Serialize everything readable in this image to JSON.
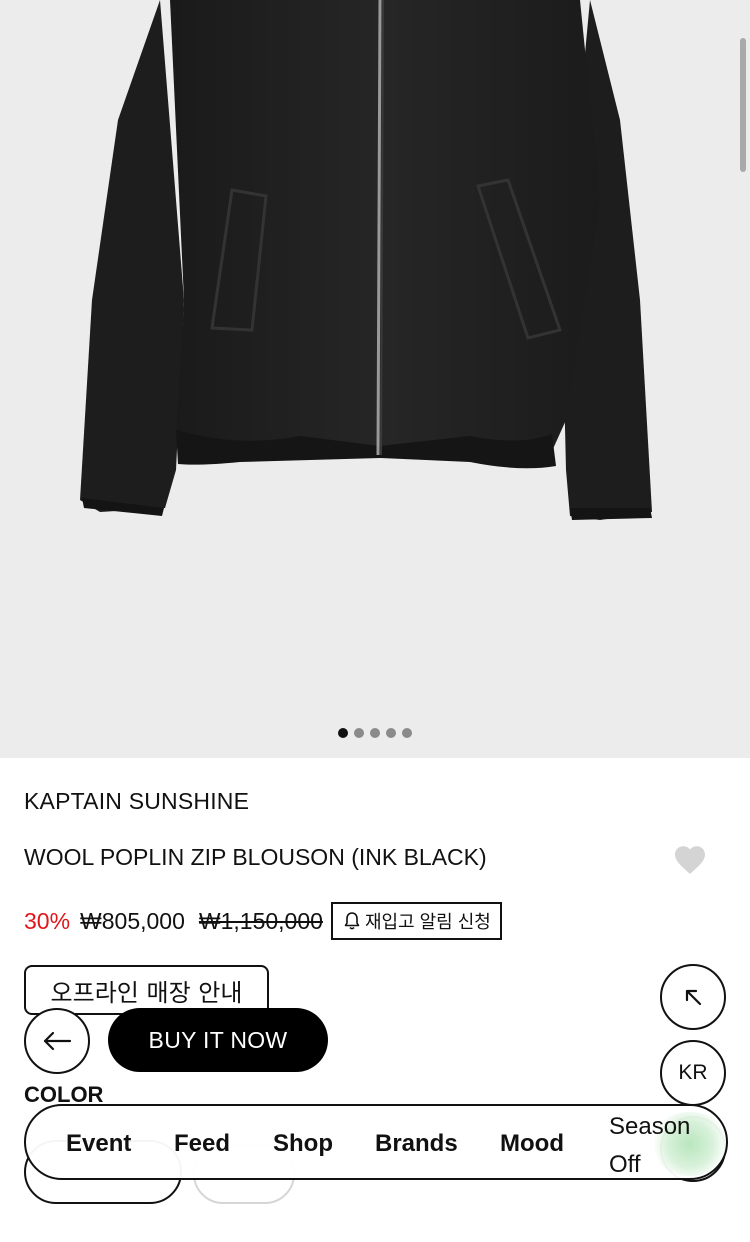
{
  "gallery": {
    "dots_count": 5,
    "active_index": 0
  },
  "product": {
    "brand": "KAPTAIN SUNSHINE",
    "name": "WOOL POPLIN ZIP BLOUSON (INK BLACK)",
    "discount": "30%",
    "sale_price": "₩805,000",
    "original_price": "₩1,150,000",
    "restock_label": "재입고 알림 신청"
  },
  "actions": {
    "offline_store_label": "오프라인 매장 안내",
    "buy_now_label": "BUY IT NOW",
    "language_label": "KR"
  },
  "options": {
    "color_label": "COLOR"
  },
  "nav": {
    "items": [
      "Event",
      "Feed",
      "Shop",
      "Brands",
      "Mood",
      "Season Off"
    ]
  },
  "colors": {
    "accent_red": "#e0161c",
    "jacket": "#1f1f1f",
    "background_gray": "#ececec"
  }
}
